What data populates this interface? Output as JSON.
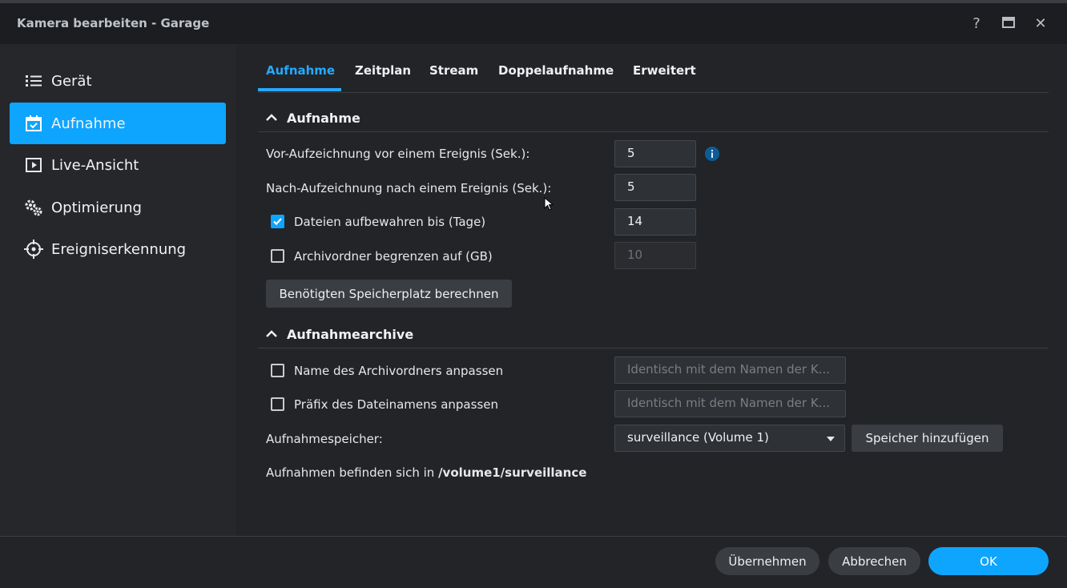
{
  "window": {
    "title": "Kamera bearbeiten - Garage",
    "help_label": "?",
    "close_label": "✕"
  },
  "sidebar": {
    "items": [
      {
        "label": "Gerät",
        "icon": "list-icon",
        "active": false
      },
      {
        "label": "Aufnahme",
        "icon": "calendar-check-icon",
        "active": true
      },
      {
        "label": "Live-Ansicht",
        "icon": "play-square-icon",
        "active": false
      },
      {
        "label": "Optimierung",
        "icon": "gears-icon",
        "active": false
      },
      {
        "label": "Ereigniserkennung",
        "icon": "crosshair-icon",
        "active": false
      }
    ]
  },
  "tabs": [
    {
      "label": "Aufnahme",
      "active": true
    },
    {
      "label": "Zeitplan",
      "active": false
    },
    {
      "label": "Stream",
      "active": false
    },
    {
      "label": "Doppelaufnahme",
      "active": false
    },
    {
      "label": "Erweitert",
      "active": false
    }
  ],
  "recording": {
    "section_title": "Aufnahme",
    "pre_record_label": "Vor-Aufzeichnung vor einem Ereignis (Sek.):",
    "pre_record_value": "5",
    "post_record_label": "Nach-Aufzeichnung nach einem Ereignis (Sek.):",
    "post_record_value": "5",
    "keep_files_label": "Dateien aufbewahren bis (Tage)",
    "keep_files_checked": true,
    "keep_files_value": "14",
    "limit_archive_label": "Archivordner begrenzen auf (GB)",
    "limit_archive_checked": false,
    "limit_archive_value": "10",
    "calc_button": "Benötigten Speicherplatz berechnen"
  },
  "archive": {
    "section_title": "Aufnahmearchive",
    "folder_name_label": "Name des Archivordners anpassen",
    "folder_name_placeholder": "Identisch mit dem Namen der K...",
    "prefix_label": "Präfix des Dateinamens anpassen",
    "prefix_placeholder": "Identisch mit dem Namen der K...",
    "storage_label": "Aufnahmespeicher:",
    "storage_value": "surveillance (Volume 1)",
    "add_storage_button": "Speicher hinzufügen",
    "location_text": "Aufnahmen befinden sich in",
    "location_path": "/volume1/surveillance"
  },
  "footer": {
    "apply": "Übernehmen",
    "cancel": "Abbrechen",
    "ok": "OK"
  },
  "colors": {
    "accent": "#0ea5ff",
    "background": "#222428",
    "sidebar": "#25272b"
  }
}
